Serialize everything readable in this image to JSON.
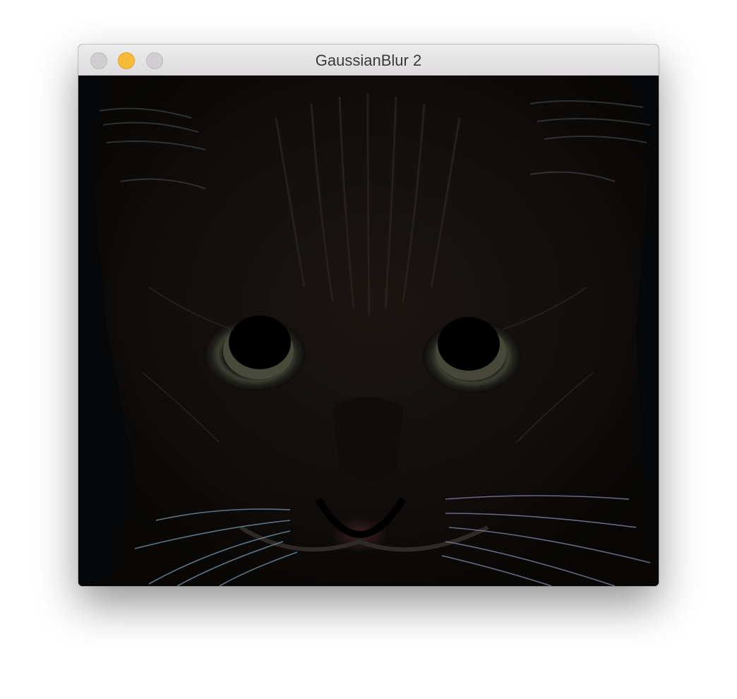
{
  "window": {
    "title": "GaussianBlur 2",
    "buttons": [
      {
        "name": "close",
        "color": "#d0ced0"
      },
      {
        "name": "minimize",
        "color": "#f8bb38"
      },
      {
        "name": "zoom",
        "color": "#d0ced0"
      }
    ]
  },
  "image": {
    "subject": "kitten-face",
    "style": "edge-detected dark render"
  }
}
